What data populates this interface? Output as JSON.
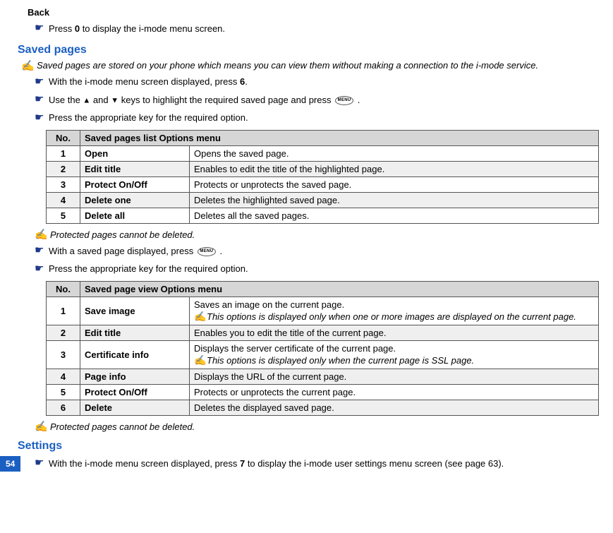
{
  "back": {
    "title": "Back",
    "line": "Press ",
    "key": "0",
    "line2": " to display the i-mode menu screen."
  },
  "saved_pages": {
    "title": "Saved pages",
    "intro": "Saved pages are stored on your phone which means you can view them without making a connection to the i-mode service.",
    "step1a": "With the i-mode menu screen displayed, press ",
    "step1_key": "6",
    "step1b": ".",
    "step2a": "Use the ",
    "step2b": " and ",
    "step2c": " keys to highlight the required saved page and press ",
    "step2d": " .",
    "step3": "Press the appropriate key for the required option.",
    "menu_label": "MENU",
    "table1": {
      "headers": {
        "no": "No.",
        "menu": "Saved pages list Options menu"
      },
      "rows": [
        {
          "no": "1",
          "name": "Open",
          "desc": "Opens the saved page."
        },
        {
          "no": "2",
          "name": "Edit title",
          "desc": "Enables to edit the title of the highlighted page."
        },
        {
          "no": "3",
          "name": "Protect On/Off",
          "desc": "Protects or unprotects the saved page."
        },
        {
          "no": "4",
          "name": "Delete one",
          "desc": "Deletes the highlighted saved page."
        },
        {
          "no": "5",
          "name": "Delete all",
          "desc": "Deletes all the saved pages."
        }
      ]
    },
    "note1": "Protected pages cannot be deleted.",
    "step4a": "With a saved page displayed, press ",
    "step4b": " .",
    "step5": "Press the appropriate key for the required option.",
    "table2": {
      "headers": {
        "no": "No.",
        "menu": "Saved page view Options menu"
      },
      "rows": [
        {
          "no": "1",
          "name": "Save image",
          "desc": "Saves an image on the current page.",
          "note": "This options is displayed only when one or more images are displayed on the current page."
        },
        {
          "no": "2",
          "name": "Edit title",
          "desc": "Enables you to edit the title of the current page."
        },
        {
          "no": "3",
          "name": "Certificate info",
          "desc": "Displays the server certificate of the current page.",
          "note": "This options is displayed only when the current page is SSL page."
        },
        {
          "no": "4",
          "name": "Page info",
          "desc": "Displays the URL of the current page."
        },
        {
          "no": "5",
          "name": "Protect On/Off",
          "desc": "Protects or unprotects the current page."
        },
        {
          "no": "6",
          "name": "Delete",
          "desc": "Deletes the displayed saved page."
        }
      ]
    },
    "note2": "Protected pages cannot be deleted."
  },
  "settings": {
    "title": "Settings",
    "line1a": "With the i-mode menu screen displayed, press ",
    "line1_key": "7",
    "line1b": " to display the i-mode user settings menu screen (see page 63)."
  },
  "page_number": "54"
}
